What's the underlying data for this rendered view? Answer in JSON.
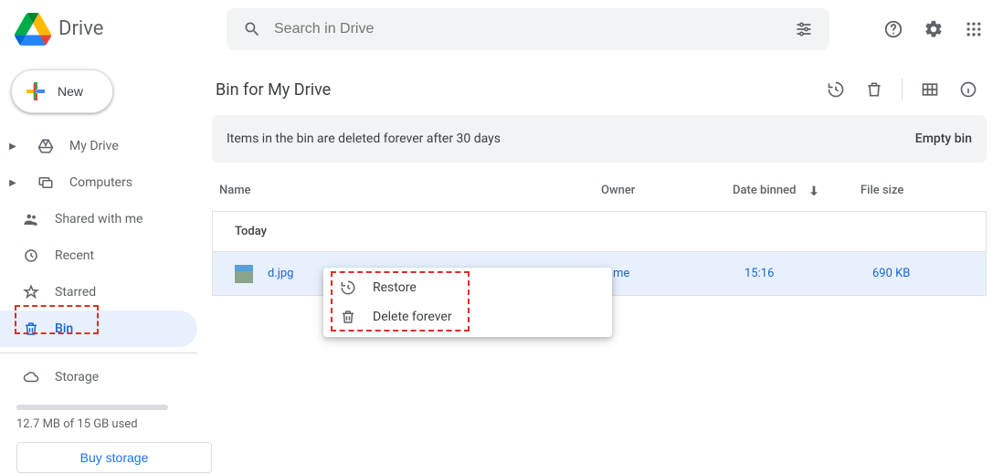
{
  "header": {
    "product": "Drive",
    "search_placeholder": "Search in Drive"
  },
  "sidebar": {
    "new_label": "New",
    "items": [
      {
        "label": "My Drive"
      },
      {
        "label": "Computers"
      },
      {
        "label": "Shared with me"
      },
      {
        "label": "Recent"
      },
      {
        "label": "Starred"
      },
      {
        "label": "Bin"
      },
      {
        "label": "Storage"
      }
    ],
    "storage_used": "12.7 MB of 15 GB used",
    "buy_label": "Buy storage"
  },
  "main": {
    "title": "Bin for My Drive",
    "banner_text": "Items in the bin are deleted forever after 30 days",
    "banner_action": "Empty bin",
    "columns": {
      "name": "Name",
      "owner": "Owner",
      "binned": "Date binned",
      "size": "File size"
    },
    "group_label": "Today",
    "file": {
      "name": "d.jpg",
      "owner": "me",
      "binned": "15:16",
      "size": "690 KB"
    }
  },
  "context_menu": {
    "restore": "Restore",
    "delete": "Delete forever"
  }
}
